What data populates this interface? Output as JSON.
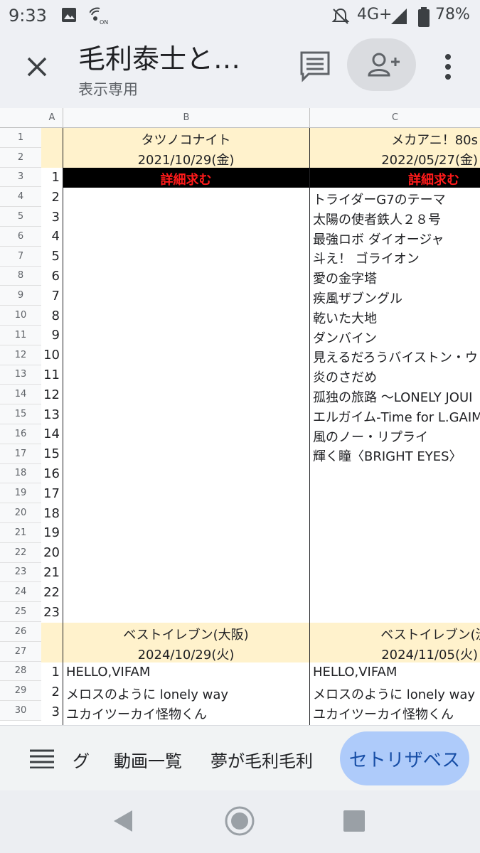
{
  "status_bar": {
    "time": "9:33",
    "network": "4G+",
    "battery": "78%"
  },
  "header": {
    "title": "毛利泰士と…",
    "subtitle": "表示専用"
  },
  "sheet": {
    "columns": [
      "A",
      "B",
      "C"
    ],
    "row_numbers": [
      "1",
      "2",
      "3",
      "4",
      "5",
      "6",
      "7",
      "8",
      "9",
      "10",
      "11",
      "12",
      "13",
      "14",
      "15",
      "16",
      "17",
      "18",
      "19",
      "20",
      "21",
      "22",
      "23",
      "24",
      "25",
      "26",
      "27",
      "28",
      "29",
      "30"
    ],
    "event_b1_name": "タツノコナイト",
    "event_b1_date": "2021/10/29(金)",
    "event_c1_name": "メカアニ！80s",
    "event_c1_date": "2022/05/27(金)",
    "detail_request_b": "詳細求む",
    "detail_request_c": "詳細求む",
    "index_numbers": [
      "1",
      "2",
      "3",
      "4",
      "5",
      "6",
      "7",
      "8",
      "9",
      "10",
      "11",
      "12",
      "13",
      "14",
      "15",
      "16",
      "17",
      "18",
      "19",
      "20",
      "21",
      "22",
      "23"
    ],
    "songs_c": [
      "トライダーG7のテーマ",
      "太陽の使者鉄人２８号",
      "最強ロボ ダイオージャ",
      "斗え！ ゴライオン",
      "愛の金字塔",
      "疾風ザブングル",
      "乾いた大地",
      "ダンバイン",
      "見えるだろうバイストン・ウ",
      "炎のさだめ",
      "孤独の旅路 〜LONELY JOUI",
      "エルガイム-Time for L.GAIM",
      "風のノー・リプライ",
      "輝く瞳〈BRIGHT EYES〉"
    ],
    "event_b2_name": "ベストイレブン(大阪)",
    "event_b2_date": "2024/10/29(火)",
    "event_c2_name": "ベストイレブン(渋",
    "event_c2_date": "2024/11/05(火)",
    "lower_numbers": [
      "1",
      "2",
      "3"
    ],
    "lower_songs_b": [
      "HELLO,VIFAM",
      "メロスのように lonely way",
      "ユカイツーカイ怪物くん"
    ],
    "lower_songs_c": [
      "HELLO,VIFAM",
      "メロスのように lonely way",
      "ユカイツーカイ怪物くん"
    ]
  },
  "tabs": {
    "tab1": "グ",
    "tab2": "動画一覧",
    "tab3": "夢が毛利毛利",
    "active": "セトリザベス"
  },
  "colors": {
    "header_band": "#fff2cc",
    "detail_band": "#000000",
    "detail_text": "#ff1a1a",
    "active_tab": "#aecbfa"
  }
}
